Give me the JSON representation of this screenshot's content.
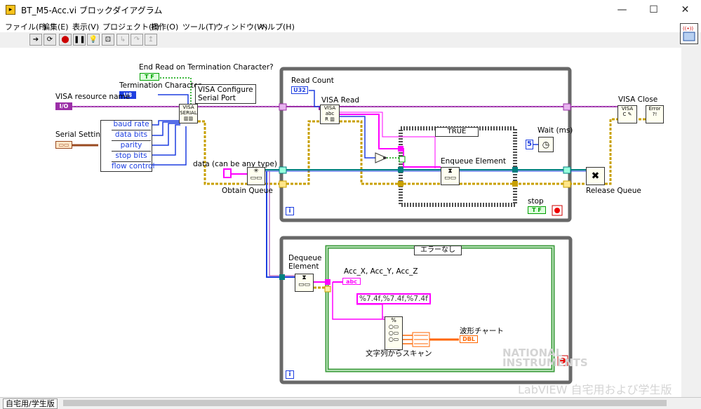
{
  "window": {
    "title": "BT_M5-Acc.vi ブロックダイアグラム",
    "icon": "labview-vi-icon",
    "minimize": "—",
    "maximize": "☐",
    "close": "✕"
  },
  "menu": [
    "ファイル(F)",
    "編集(E)",
    "表示(V)",
    "プロジェクト(P)",
    "操作(O)",
    "ツール(T)",
    "ウィンドウ(W)",
    "ヘルプ(H)"
  ],
  "toolbar": {
    "buttons": [
      "run-arrow-icon",
      "run-continuous-icon",
      "abort-icon",
      "pause-icon",
      "highlight-execution-icon",
      "retain-wire-values-icon",
      "step-into-icon",
      "step-over-icon",
      "step-out-icon"
    ]
  },
  "diagram": {
    "labels": {
      "end_read": "End Read on Termination Character?",
      "termination_char": "Termination Character",
      "visa_resource": "VISA resource name",
      "serial_settings": "Serial Settings",
      "visa_configure": "VISA Configure\nSerial Port",
      "data_any": "data (can be any type)",
      "obtain_queue": "Obtain Queue",
      "read_count": "Read Count",
      "visa_read": "VISA Read",
      "case_true": "TRUE",
      "enqueue": "Enqueue Element",
      "wait_ms": "Wait (ms)",
      "stop": "stop",
      "visa_close": "VISA Close",
      "release_queue": "Release Queue",
      "dequeue": "Dequeue\nElement",
      "case_no_error": "エラーなし",
      "acc_labels": "Acc_X,  Acc_Y,  Acc_Z",
      "format": "%7.4f,%7.4f,%7.4f",
      "scan_string": "文字列からスキャン",
      "waveform_chart": "波形チャート"
    },
    "cluster_items": [
      "baud rate",
      "data bits",
      "parity",
      "stop bits",
      "flow control"
    ],
    "constants": {
      "bool_tf": "T F",
      "u8": "U8",
      "u32": "U32",
      "i32": "I32",
      "wait_value": "5",
      "dbl": "DBL",
      "abc": "abc",
      "loop_i": "i"
    },
    "colors": {
      "string_pink": "#ff00ff",
      "error_yellow": "#c8a000",
      "refnum_purple": "#9b2fa7",
      "queue_teal": "#008080",
      "loop_border": "#686868",
      "case_green": "#3a9a3a",
      "numeric_blue": "#1e3fe0",
      "bool_green": "#00a000",
      "orange": "#ff6600"
    }
  },
  "bottom": {
    "context": "自宅用/学生版",
    "watermark_line1": "NATIONAL\nINSTRUMENTS",
    "watermark_line2": "LabVIEW  自宅用および学生版"
  }
}
